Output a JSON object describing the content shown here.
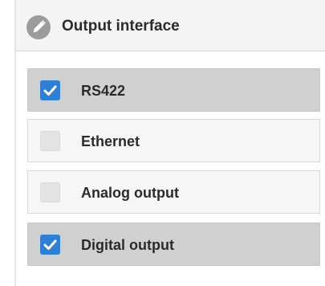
{
  "header": {
    "icon": "pencil-icon",
    "title": "Output interface"
  },
  "options": [
    {
      "label": "RS422",
      "checked": true
    },
    {
      "label": "Ethernet",
      "checked": false
    },
    {
      "label": "Analog output",
      "checked": false
    },
    {
      "label": "Digital output",
      "checked": true
    }
  ],
  "colors": {
    "checkbox_checked": "#2f7fd3",
    "selected_row": "#d0d0d0",
    "unselected_row": "#f6f6f6",
    "header_background": "#f4f4f4"
  }
}
